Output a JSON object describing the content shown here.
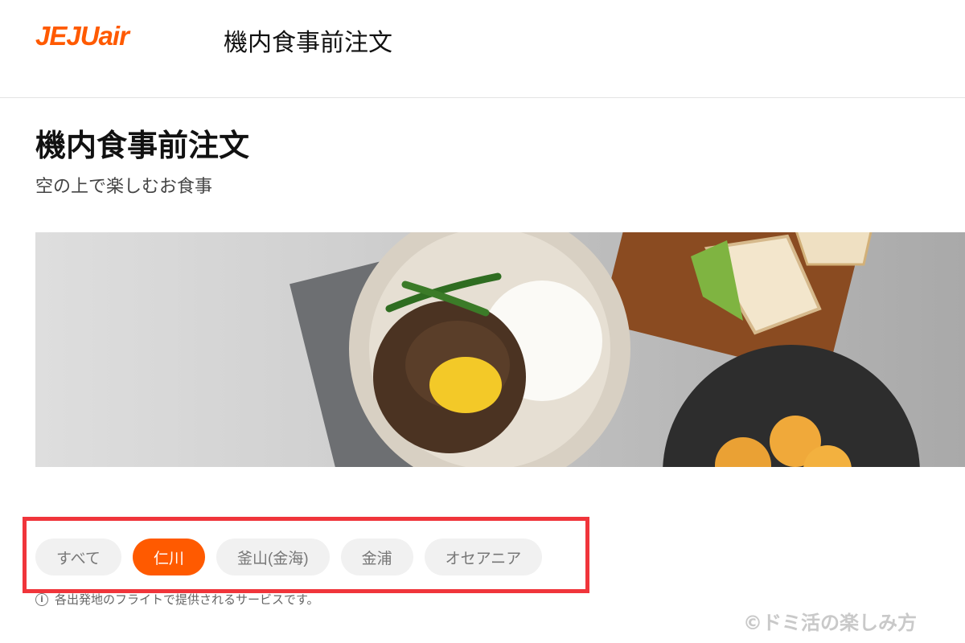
{
  "header": {
    "logo_text": "JEJUair",
    "title": "機内食事前注文"
  },
  "main": {
    "title": "機内食事前注文",
    "subtitle": "空の上で楽しむお食事",
    "hero_image": "in-flight meal photo: bulgogi rice plate, sandwiches, fried chicken"
  },
  "filters": {
    "chips": [
      {
        "label": "すべて",
        "selected": false
      },
      {
        "label": "仁川",
        "selected": true
      },
      {
        "label": "釜山(金海)",
        "selected": false
      },
      {
        "label": "金浦",
        "selected": false
      },
      {
        "label": "オセアニア",
        "selected": false
      }
    ],
    "notice": "各出発地のフライトで提供されるサービスです。",
    "notice_icon": "info-icon"
  },
  "watermark": "©ドミ活の楽しみ方",
  "colors": {
    "brand": "#ff5a00",
    "highlight_border": "#f0353b"
  }
}
